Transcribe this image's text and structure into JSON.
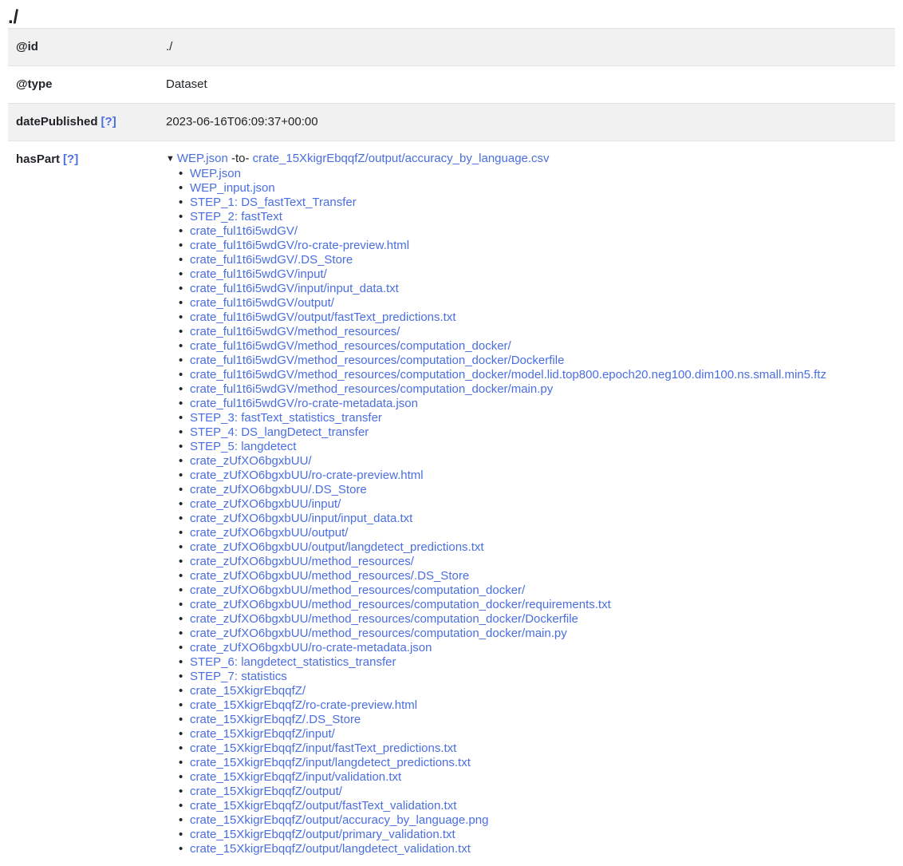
{
  "page": {
    "title": "./"
  },
  "help_label": "[?]",
  "metadata": {
    "rows": [
      {
        "key": "@id",
        "has_help": false,
        "value": "./"
      },
      {
        "key": "@type",
        "has_help": false,
        "value": "Dataset"
      },
      {
        "key": "datePublished",
        "has_help": true,
        "value": "2023-06-16T06:09:37+00:00"
      },
      {
        "key": "hasPart",
        "has_help": true,
        "value": ""
      }
    ]
  },
  "has_part": {
    "triangle": "▼",
    "summary": {
      "first": "WEP.json",
      "separator": "-to-",
      "last": "crate_15XkigrEbqqfZ/output/accuracy_by_language.csv"
    },
    "items": [
      "WEP.json",
      "WEP_input.json",
      "STEP_1: DS_fastText_Transfer",
      "STEP_2: fastText",
      "crate_ful1t6i5wdGV/",
      "crate_ful1t6i5wdGV/ro-crate-preview.html",
      "crate_ful1t6i5wdGV/.DS_Store",
      "crate_ful1t6i5wdGV/input/",
      "crate_ful1t6i5wdGV/input/input_data.txt",
      "crate_ful1t6i5wdGV/output/",
      "crate_ful1t6i5wdGV/output/fastText_predictions.txt",
      "crate_ful1t6i5wdGV/method_resources/",
      "crate_ful1t6i5wdGV/method_resources/computation_docker/",
      "crate_ful1t6i5wdGV/method_resources/computation_docker/Dockerfile",
      "crate_ful1t6i5wdGV/method_resources/computation_docker/model.lid.top800.epoch20.neg100.dim100.ns.small.min5.ftz",
      "crate_ful1t6i5wdGV/method_resources/computation_docker/main.py",
      "crate_ful1t6i5wdGV/ro-crate-metadata.json",
      "STEP_3: fastText_statistics_transfer",
      "STEP_4: DS_langDetect_transfer",
      "STEP_5: langdetect",
      "crate_zUfXO6bgxbUU/",
      "crate_zUfXO6bgxbUU/ro-crate-preview.html",
      "crate_zUfXO6bgxbUU/.DS_Store",
      "crate_zUfXO6bgxbUU/input/",
      "crate_zUfXO6bgxbUU/input/input_data.txt",
      "crate_zUfXO6bgxbUU/output/",
      "crate_zUfXO6bgxbUU/output/langdetect_predictions.txt",
      "crate_zUfXO6bgxbUU/method_resources/",
      "crate_zUfXO6bgxbUU/method_resources/.DS_Store",
      "crate_zUfXO6bgxbUU/method_resources/computation_docker/",
      "crate_zUfXO6bgxbUU/method_resources/computation_docker/requirements.txt",
      "crate_zUfXO6bgxbUU/method_resources/computation_docker/Dockerfile",
      "crate_zUfXO6bgxbUU/method_resources/computation_docker/main.py",
      "crate_zUfXO6bgxbUU/ro-crate-metadata.json",
      "STEP_6: langdetect_statistics_transfer",
      "STEP_7: statistics",
      "crate_15XkigrEbqqfZ/",
      "crate_15XkigrEbqqfZ/ro-crate-preview.html",
      "crate_15XkigrEbqqfZ/.DS_Store",
      "crate_15XkigrEbqqfZ/input/",
      "crate_15XkigrEbqqfZ/input/fastText_predictions.txt",
      "crate_15XkigrEbqqfZ/input/langdetect_predictions.txt",
      "crate_15XkigrEbqqfZ/input/validation.txt",
      "crate_15XkigrEbqqfZ/output/",
      "crate_15XkigrEbqqfZ/output/fastText_validation.txt",
      "crate_15XkigrEbqqfZ/output/accuracy_by_language.png",
      "crate_15XkigrEbqqfZ/output/primary_validation.txt",
      "crate_15XkigrEbqqfZ/output/langdetect_validation.txt"
    ]
  },
  "colors": {
    "link": "#4a6ee0",
    "text": "#212529",
    "stripe": "#f1f1f1",
    "border": "#e3e3e6"
  }
}
